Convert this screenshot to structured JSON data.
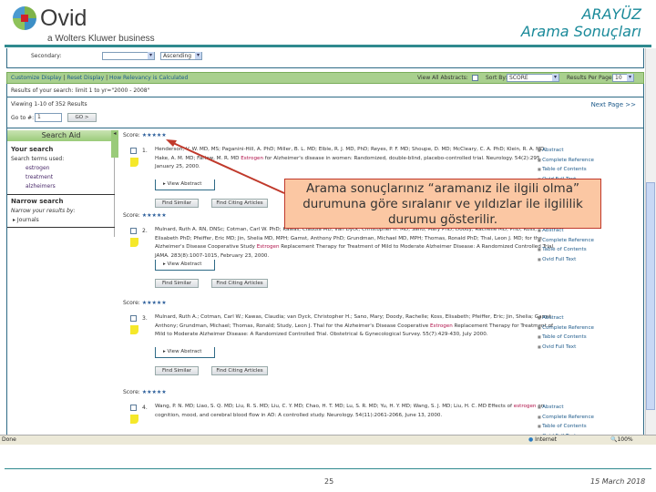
{
  "header": {
    "logo_text": "Ovid",
    "logo_tagline": "a Wolters Kluwer business",
    "title_line1": "ARAYÜZ",
    "title_line2": "Arama Sonuçları"
  },
  "sort": {
    "secondary_label": "Secondary:",
    "secondary_value": "",
    "order_value": "Ascending"
  },
  "toolbar": {
    "customize": "Customize Display",
    "reset": "Reset Display",
    "how_relevancy": "How Relevancy is Calculated",
    "view_all_abstracts": "View All Abstracts:",
    "sort_by_label": "Sort By:",
    "sort_by_value": "SCORE",
    "results_per_page_label": "Results Per Page:",
    "results_per_page_value": "10"
  },
  "results_of_search": "Results of your search: limit 1 to yr=\"2000 - 2008\"",
  "viewing": "Viewing 1-10 of 352 Results",
  "next_page": "Next Page >>",
  "goto": {
    "label": "Go to #:",
    "value": "1",
    "button": "GO >"
  },
  "sidebar": {
    "title": "Search Aid",
    "your_search": "Your search",
    "terms_used": "Search terms used:",
    "terms": [
      "estrogen",
      "treatment",
      "alzheimers"
    ],
    "narrow_search": "Narrow search",
    "narrow_by": "Narrow your results by:",
    "journals": "Journals"
  },
  "results": [
    {
      "score_label": "Score:",
      "stars": "★★★★★",
      "num": "1.",
      "pre": "Henderson, V. W. MD, MS; Paganini-Hill, A. PhD; Miller, B. L. MD; Elble, R. J. MD, PhD; Reyes, P. F. MD; Shoupe, D. MD; McCleary, C. A. PhD; Klein, R. A. MD; Hake, A. M. MD; Farlow, M. R. MD ",
      "hl": "Estrogen",
      "post": " for Alzheimer's disease in women: Randomized, double-blind, placebo-controlled trial. Neurology. 54(2):295, January 25, 2000.",
      "view_abstract": "View Abstract",
      "find_similar": "Find Similar",
      "find_citing": "Find Citing Articles",
      "links": [
        "Abstract",
        "Complete Reference",
        "Table of Contents",
        "Ovid Full Text"
      ]
    },
    {
      "score_label": "Score:",
      "stars": "★★★★★",
      "num": "2.",
      "pre": "Mulnard, Ruth A. RN, DNSc; Cotman, Carl W. PhD; Kawas, Claudia MD; van Dyck, Christopher H. MD; Sano, Mary PhD; Doody, Rachelle MD, PhD; Koss, Elisabeth PhD; Pfeiffer, Eric MD; Jin, Shelia MD, MPH; Gamst, Anthony PhD; Grundman, Michael MD, MPH; Thomas, Ronald PhD; Thal, Leon J. MD; for the Alzheimer's Disease Cooperative Study ",
      "hl": "Estrogen",
      "post": " Replacement Therapy for Treatment of Mild to Moderate Alzheimer Disease: A Randomized Controlled Trial. JAMA. 283(8):1007-1015, February 23, 2000.",
      "view_abstract": "View Abstract",
      "find_similar": "Find Similar",
      "find_citing": "Find Citing Articles",
      "links": [
        "Abstract",
        "Complete Reference",
        "Table of Contents",
        "Ovid Full Text"
      ]
    },
    {
      "score_label": "Score:",
      "stars": "★★★★★",
      "num": "3.",
      "pre": "Mulnard, Ruth A.; Cotman, Carl W.; Kawas, Claudia; van Dyck, Christopher H.; Sano, Mary; Doody, Rachelle; Koss, Elisabeth; Pfeiffer, Eric; Jin, Shelia; Gamst, Anthony; Grundman, Michael; Thomas, Ronald; Study, Leon J. Thal for the Alzheimer's Disease Cooperative ",
      "hl": "Estrogen",
      "post": " Replacement Therapy for Treatment of Mild to Moderate Alzheimer Disease: A Randomized Controlled Trial. Obstetrical & Gynecological Survey. 55(7):429-430, July 2000.",
      "view_abstract": "View Abstract",
      "find_similar": "Find Similar",
      "find_citing": "Find Citing Articles",
      "links": [
        "Abstract",
        "Complete Reference",
        "Table of Contents",
        "Ovid Full Text"
      ]
    },
    {
      "score_label": "Score:",
      "stars": "★★★★★",
      "num": "4.",
      "pre": "Wang, P. N. MD; Liao, S. Q. MD; Liu, R. S. MD; Liu, C. Y. MD; Chao, H. T. MD; Lu, S. R. MD; Yu, H. Y. MD; Wang, S. J. MD; Liu, H. C. MD Effects of ",
      "hl": "estrogen",
      "post": " on cognition, mood, and cerebral blood flow in AD: A controlled study. Neurology. 54(11):2061-2066, June 13, 2000.",
      "links": [
        "Abstract",
        "Complete Reference",
        "Table of Contents",
        "Ovid Full Text"
      ]
    }
  ],
  "callout": "Arama sonuçlarınız “aramanız ile ilgili olma” durumuna göre sıralanır ve yıldızlar ile ilgililik durumu gösterilir.",
  "statusbar": {
    "status": "Done",
    "zone": "Internet",
    "zoom": "100%"
  },
  "footer": {
    "page": "25",
    "date": "15 March 2018"
  },
  "colors": {
    "accent": "#2f8a8f",
    "toolbar_green": "#a9d08e",
    "callout_fill": "#fbc7a3",
    "callout_border": "#c0392b",
    "highlight": "#b0124a"
  }
}
